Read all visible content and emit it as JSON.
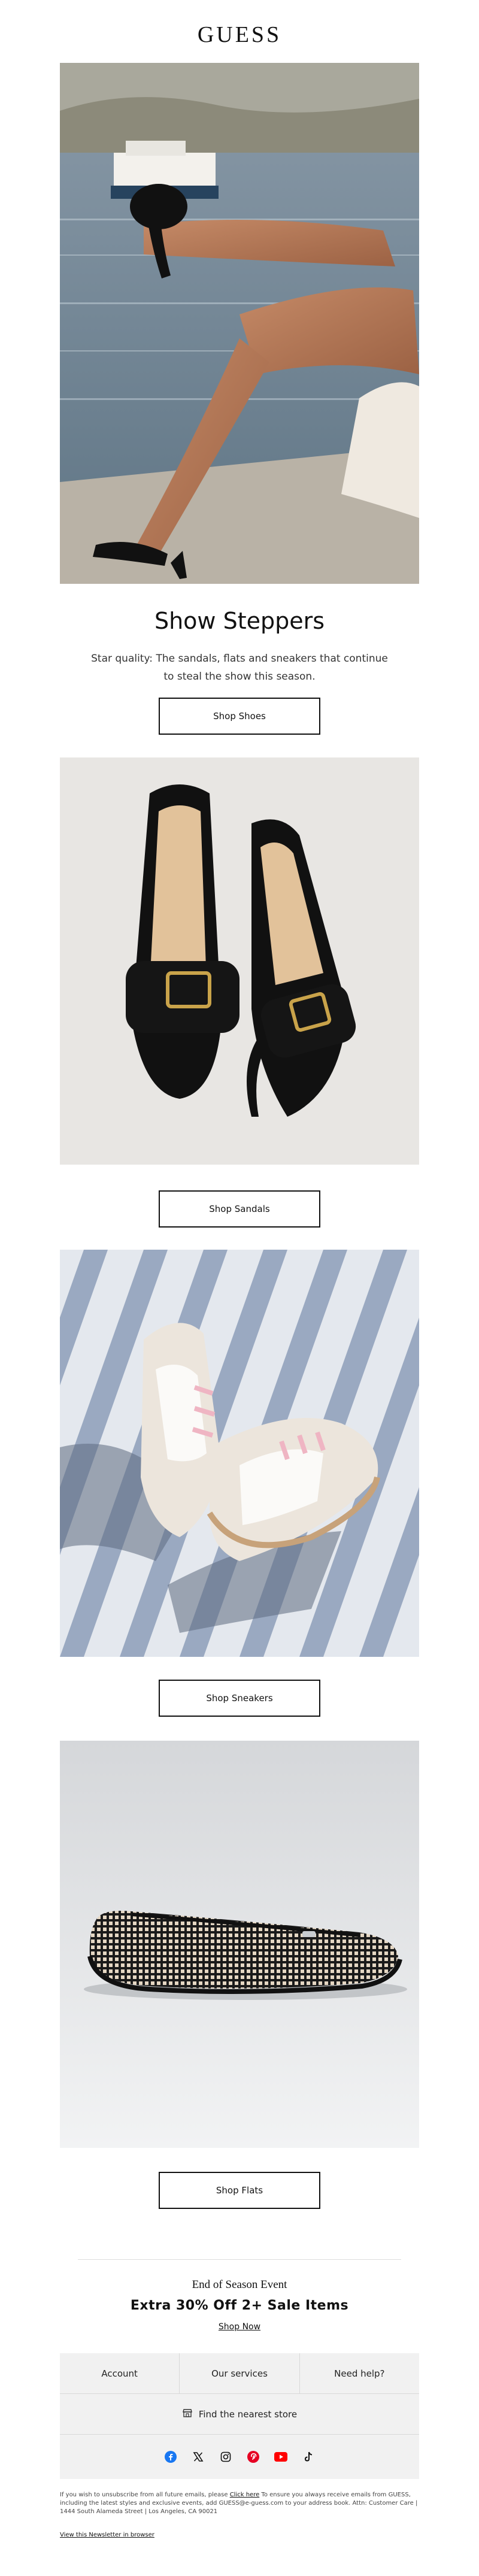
{
  "brand": {
    "logo": "GUESS"
  },
  "hero": {
    "headline": "Show Steppers",
    "subcopy": "Star quality: The sandals, flats and sneakers that continue to steal the show this season.",
    "cta": "Shop Shoes"
  },
  "sections": [
    {
      "cta": "Shop Sandals"
    },
    {
      "cta": "Shop Sneakers"
    },
    {
      "cta": "Shop Flats"
    }
  ],
  "promo": {
    "eyebrow": "End of Season Event",
    "title": "Extra 30% Off 2+ Sale Items",
    "link": "Shop Now"
  },
  "footer": {
    "links": [
      "Account",
      "Our services",
      "Need help?"
    ],
    "store_finder": "Find the nearest store",
    "social_icons": [
      "facebook-icon",
      "x-icon",
      "instagram-icon",
      "pinterest-icon",
      "youtube-icon",
      "tiktok-icon"
    ]
  },
  "legal": {
    "text_before_link": "If you wish to unsubscribe from all future emails, please ",
    "link": "Click here",
    "text_after_link": " To ensure you always receive emails from GUESS, including the latest styles and exclusive events, add GUESS@e-guess.com to your address book. Attn: Customer Care | 1444 South Alameda Street | Los Angeles, CA 90021",
    "view_in_browser": "View this Newsletter in browser"
  },
  "colors": {
    "text": "#111111",
    "footer_bg": "#f1f1f1",
    "facebook": "#1877f2",
    "pinterest": "#e60023",
    "youtube": "#ff0000"
  }
}
